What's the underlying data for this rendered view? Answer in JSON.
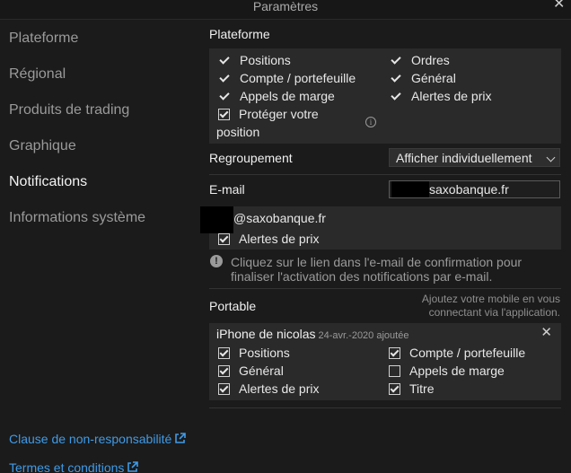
{
  "window": {
    "title": "Paramètres",
    "close_glyph": "✕"
  },
  "sidebar": {
    "items": [
      {
        "label": "Plateforme",
        "active": false
      },
      {
        "label": "Régional",
        "active": false
      },
      {
        "label": "Produits de trading",
        "active": false
      },
      {
        "label": "Graphique",
        "active": false
      },
      {
        "label": "Notifications",
        "active": true
      },
      {
        "label": "Informations système",
        "active": false
      }
    ],
    "links": [
      {
        "label": "Clause de non-responsabilité",
        "icon": "external-link-icon"
      },
      {
        "label": "Termes et conditions",
        "icon": "external-link-icon"
      }
    ]
  },
  "plateforme": {
    "title": "Plateforme",
    "left": [
      "Positions",
      "Compte / portefeuille",
      "Appels de marge"
    ],
    "right": [
      "Ordres",
      "Général",
      "Alertes de prix"
    ],
    "protect": {
      "line1": "Protéger votre",
      "line2": "position",
      "checked": true
    },
    "info_glyph": "i"
  },
  "regroupement": {
    "label": "Regroupement",
    "value": "Afficher individuellement"
  },
  "email": {
    "label": "E-mail",
    "field_value": "saxobanque.fr",
    "address": "@saxobanque.fr",
    "alerts_label": "Alertes de prix",
    "alerts_checked": true,
    "note_line1": "Cliquez sur le lien dans l'e-mail de confirmation pour",
    "note_line2": "finaliser l'activation des notifications par e-mail.",
    "warn_glyph": "!"
  },
  "portable": {
    "label": "Portable",
    "hint_line1": "Ajoutez votre mobile en vous",
    "hint_line2": "connectant via l'application.",
    "device": {
      "name": "iPhone de nicolas",
      "added": "24-avr.-2020 ajoutée",
      "close_glyph": "✕",
      "options": [
        {
          "label": "Positions",
          "checked": true
        },
        {
          "label": "Compte / portefeuille",
          "checked": true
        },
        {
          "label": "Général",
          "checked": true
        },
        {
          "label": "Appels de marge",
          "checked": false
        },
        {
          "label": "Alertes de prix",
          "checked": true
        },
        {
          "label": "Titre",
          "checked": true
        }
      ]
    }
  },
  "colors": {
    "background": "#1b1b1b",
    "panel": "#2a2a2a",
    "link": "#3f9be8",
    "text": "#e8e8e8",
    "muted": "#9a9a9a"
  }
}
